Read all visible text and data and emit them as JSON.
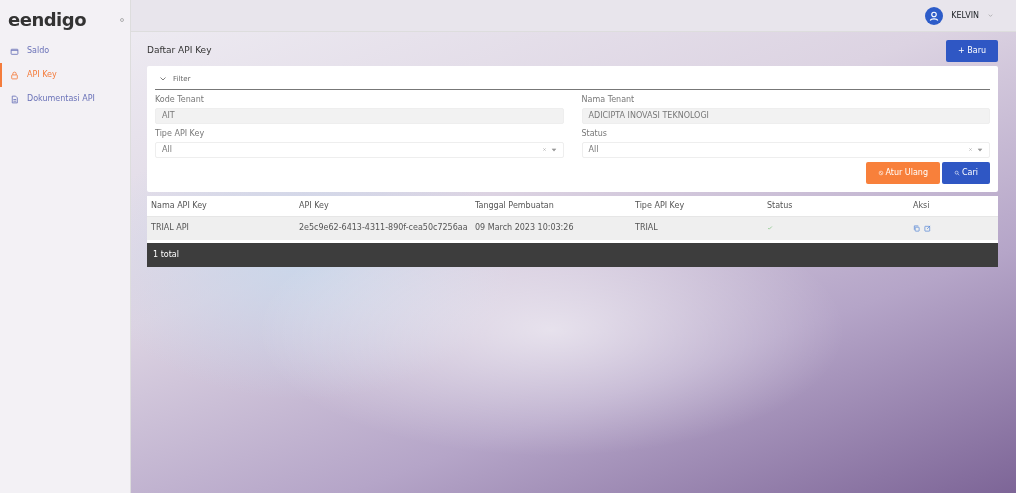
{
  "sidebar": {
    "logo": "eendigo",
    "items": [
      {
        "label": "Saldo",
        "selected": false
      },
      {
        "label": "API Key",
        "selected": true
      },
      {
        "label": "Dokumentasi API",
        "selected": false
      }
    ]
  },
  "header": {
    "user": "KELVIN"
  },
  "page": {
    "title": "Daftar API Key",
    "new_button": "+ Baru"
  },
  "filter": {
    "title": "Filter",
    "expanded": true,
    "fields": [
      {
        "label": "Kode Tenant",
        "value": "AIT",
        "kind": "readonly"
      },
      {
        "label": "Nama Tenant",
        "value": "ADICIPTA INOVASI TEKNOLOGI",
        "kind": "readonly"
      },
      {
        "label": "Tipe API Key",
        "value": "All",
        "kind": "select"
      },
      {
        "label": "Status",
        "value": "All",
        "kind": "select"
      }
    ],
    "reset_button": "Atur Ulang",
    "search_button": "Cari"
  },
  "table": {
    "columns": [
      "Nama API Key",
      "API Key",
      "Tanggal Pembuatan",
      "Tipe API Key",
      "Status",
      "Aksi"
    ],
    "rows": [
      {
        "name": "TRIAL API",
        "key": "2e5c9e62-6413-4311-890f-cea50c7256aa",
        "created": "09 March 2023 10:03:26",
        "type": "TRIAL",
        "active": true
      }
    ],
    "footer": "1 total"
  }
}
